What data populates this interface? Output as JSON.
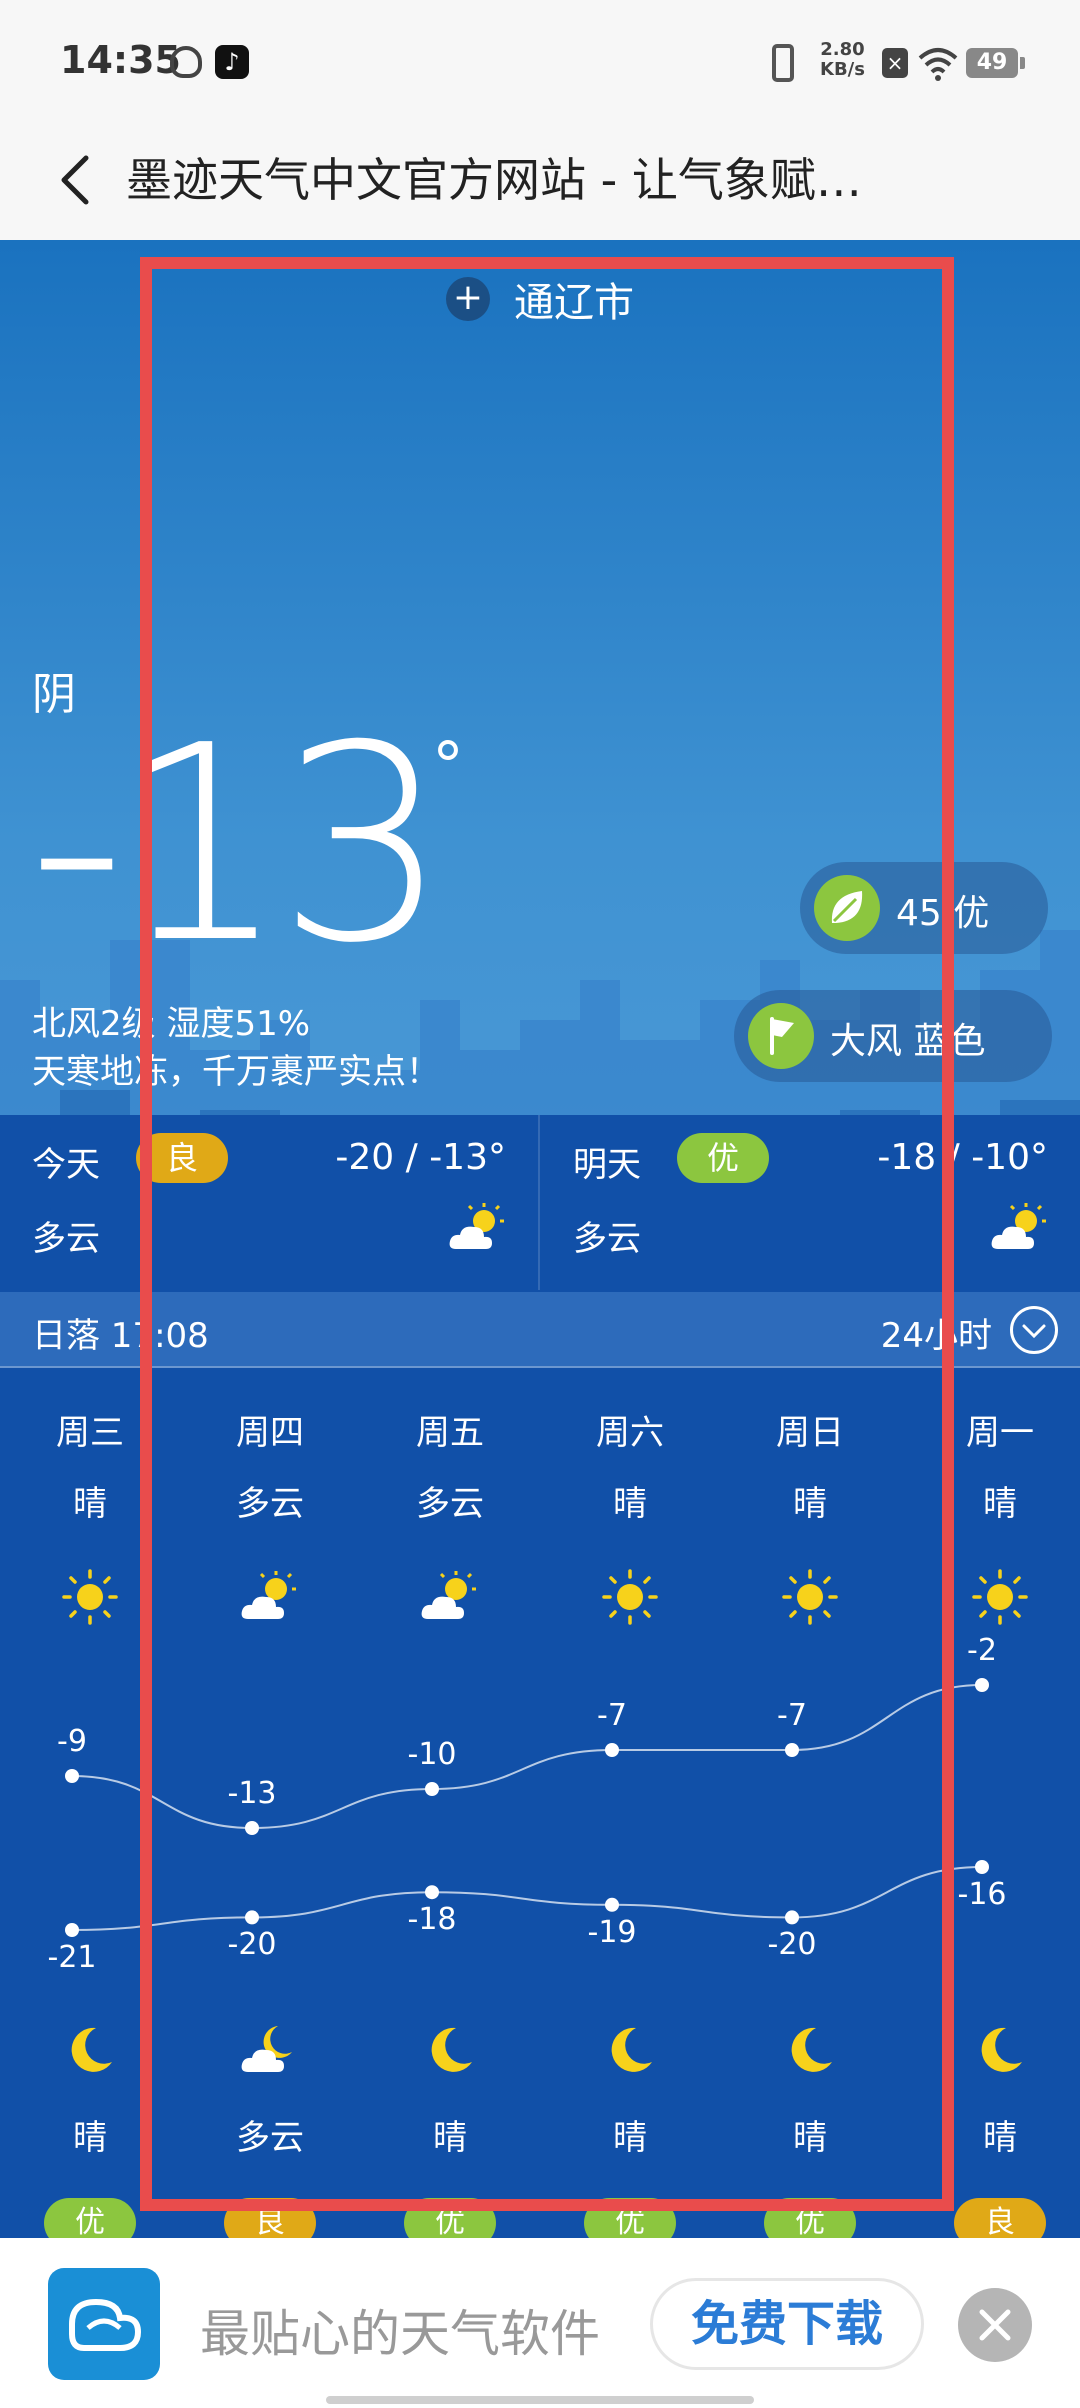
{
  "status_bar": {
    "time": "14:35",
    "speed": "2.80",
    "speed_unit": "KB/s",
    "battery": "49"
  },
  "titlebar": {
    "title": "墨迹天气中文官方网站 - 让气象赋…"
  },
  "weather": {
    "city": "通辽市",
    "condition": "阴",
    "temperature": "-13",
    "degree": "°",
    "wind_humidity": "北风2级 湿度51%",
    "tip": "天寒地冻，千万裹严实点！",
    "aqi_value": "45 优",
    "alert": "大风 蓝色"
  },
  "today": {
    "name": "今天",
    "aqi": "良",
    "range": "-20 / -13°",
    "cond": "多云"
  },
  "tomorrow": {
    "name": "明天",
    "aqi": "优",
    "range": "-18 / -10°",
    "cond": "多云"
  },
  "sunset_bar": {
    "sunset": "日落 17:08",
    "hours": "24小时"
  },
  "forecast": {
    "days": [
      {
        "week": "周三",
        "day_cond": "晴",
        "day_icon": "sun",
        "high": "-9",
        "low": "-21",
        "night_icon": "moon",
        "night_cond": "晴",
        "aqi": "优",
        "aqi_color": "#8cc63f"
      },
      {
        "week": "周四",
        "day_cond": "多云",
        "day_icon": "cloud-sun",
        "high": "-13",
        "low": "-20",
        "night_icon": "cloud-moon",
        "night_cond": "多云",
        "aqi": "良",
        "aqi_color": "#e0a917"
      },
      {
        "week": "周五",
        "day_cond": "多云",
        "day_icon": "cloud-sun",
        "high": "-10",
        "low": "-18",
        "night_icon": "moon",
        "night_cond": "晴",
        "aqi": "优",
        "aqi_color": "#8cc63f"
      },
      {
        "week": "周六",
        "day_cond": "晴",
        "day_icon": "sun",
        "high": "-7",
        "low": "-19",
        "night_icon": "moon",
        "night_cond": "晴",
        "aqi": "优",
        "aqi_color": "#8cc63f"
      },
      {
        "week": "周日",
        "day_cond": "晴",
        "day_icon": "sun",
        "high": "-7",
        "low": "-20",
        "night_icon": "moon",
        "night_cond": "晴",
        "aqi": "优",
        "aqi_color": "#8cc63f"
      },
      {
        "week": "周一",
        "day_cond": "晴",
        "day_icon": "sun",
        "high": "-2",
        "low": "-16",
        "night_icon": "moon",
        "night_cond": "晴",
        "aqi": "良",
        "aqi_color": "#e0a917"
      }
    ]
  },
  "ad": {
    "text": "最贴心的天气软件",
    "button": "免费下载"
  },
  "colors": {
    "good": "#8cc63f",
    "fair": "#e0a917",
    "sun": "#f7d21b",
    "highlight_frame": "#e94c4c"
  }
}
